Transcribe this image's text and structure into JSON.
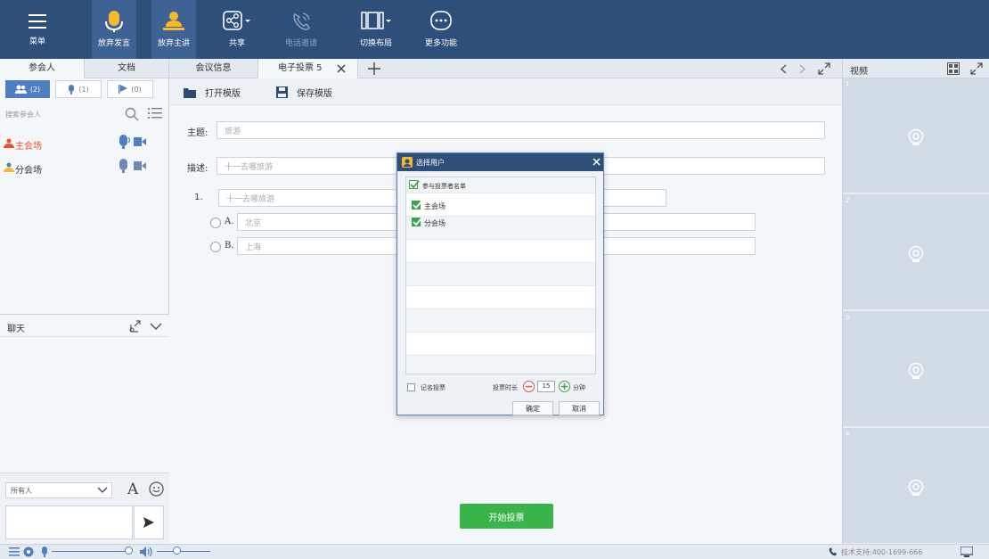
{
  "toolbar": {
    "items": [
      {
        "label": "菜单",
        "icon": "menu-icon"
      },
      {
        "label": "放弃发言",
        "icon": "microphone-icon"
      },
      {
        "label": "放弃主讲",
        "icon": "presenter-icon"
      },
      {
        "label": "共享",
        "icon": "share-icon"
      },
      {
        "label": "电话邀请",
        "icon": "phone-icon"
      },
      {
        "label": "切换布局",
        "icon": "layout-icon"
      },
      {
        "label": "更多功能",
        "icon": "more-icon"
      }
    ]
  },
  "left_panel": {
    "tabs": [
      "参会人",
      "文档"
    ],
    "filters": [
      {
        "label": "(2)",
        "icon": "users-icon"
      },
      {
        "label": "(1)",
        "icon": "microphone-icon"
      },
      {
        "label": "(0)",
        "icon": "flag-icon"
      }
    ],
    "search_placeholder": "搜索参会人",
    "attendees": [
      {
        "name": "主会场",
        "color": "#e8542f"
      },
      {
        "name": "分会场",
        "color": "#333333"
      }
    ],
    "chat": {
      "title": "聊天",
      "recipient": "所有人",
      "font_glyph": "A"
    }
  },
  "main": {
    "tabs": [
      {
        "label": "会议信息"
      },
      {
        "label": "电子投票 5"
      }
    ],
    "tools": {
      "open_template": "打开模版",
      "save_template": "保存模版"
    },
    "form": {
      "subject_label": "主题:",
      "subject_value": "旅游",
      "desc_label": "描述:",
      "desc_value": "十一去哪旅游",
      "question_number": "1.",
      "question_value": "十一去哪旅游",
      "options": [
        {
          "letter": "A.",
          "value": "北京"
        },
        {
          "letter": "B.",
          "value": "上海"
        }
      ]
    },
    "start_button": "开始投票"
  },
  "right_panel": {
    "title": "视频",
    "cells": [
      "1",
      "2",
      "3",
      "4"
    ]
  },
  "status": {
    "support": "技术支持:400-1699-666"
  },
  "dialog": {
    "title": "选择用户",
    "list_header": "参与投票者名单",
    "users": [
      "主会场",
      "分会场"
    ],
    "anonymous_label": "记名投票",
    "duration_label": "投票时长",
    "duration_value": "15",
    "duration_unit": "分钟",
    "ok": "确定",
    "cancel": "取消"
  },
  "colors": {
    "toolbar_bg": "#2f4f7b",
    "accent_green": "#39b44a",
    "mic_yellow": "#f5b82e",
    "accent_blue": "#4f7ec2"
  }
}
